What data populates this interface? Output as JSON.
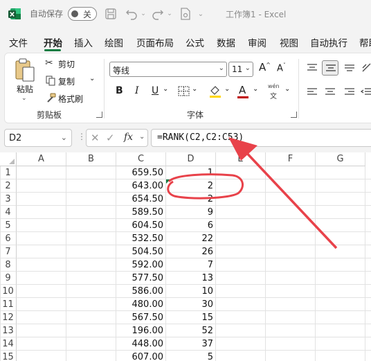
{
  "titlebar": {
    "autosave_label": "自动保存",
    "autosave_state": "关",
    "doc_title": "工作簿1  -  Excel"
  },
  "tabs": [
    "文件",
    "开始",
    "插入",
    "绘图",
    "页面布局",
    "公式",
    "数据",
    "审阅",
    "视图",
    "自动执行",
    "帮助"
  ],
  "active_tab": "开始",
  "ribbon": {
    "clipboard": {
      "paste": "粘贴",
      "cut": "剪切",
      "copy": "复制",
      "format_painter": "格式刷",
      "group_label": "剪贴板"
    },
    "font": {
      "font_name": "等线",
      "font_size": "11",
      "bold": "B",
      "italic": "I",
      "underline": "U",
      "phonetic_top": "wén",
      "phonetic_bottom": "文",
      "group_label": "字体"
    },
    "accent_color": "#107c41",
    "font_color": "#c00000"
  },
  "formula_bar": {
    "name_box": "D2",
    "fx": "fx",
    "formula": "=RANK(C2,C2:C53)"
  },
  "columns": [
    "A",
    "B",
    "C",
    "D",
    "E",
    "F",
    "G"
  ],
  "rows": [
    {
      "num": "1",
      "c": "659.50",
      "d": "1"
    },
    {
      "num": "2",
      "c": "643.00",
      "d": "2"
    },
    {
      "num": "3",
      "c": "654.50",
      "d": "2"
    },
    {
      "num": "4",
      "c": "589.50",
      "d": "9"
    },
    {
      "num": "5",
      "c": "604.50",
      "d": "6"
    },
    {
      "num": "6",
      "c": "532.50",
      "d": "22"
    },
    {
      "num": "7",
      "c": "504.50",
      "d": "26"
    },
    {
      "num": "8",
      "c": "592.00",
      "d": "7"
    },
    {
      "num": "9",
      "c": "577.50",
      "d": "13"
    },
    {
      "num": "10",
      "c": "586.00",
      "d": "10"
    },
    {
      "num": "11",
      "c": "480.00",
      "d": "30"
    },
    {
      "num": "12",
      "c": "567.50",
      "d": "15"
    },
    {
      "num": "13",
      "c": "196.00",
      "d": "52"
    },
    {
      "num": "14",
      "c": "448.00",
      "d": "37"
    },
    {
      "num": "15",
      "c": "607.00",
      "d": "5"
    }
  ],
  "annotation_color": "#e8424a"
}
